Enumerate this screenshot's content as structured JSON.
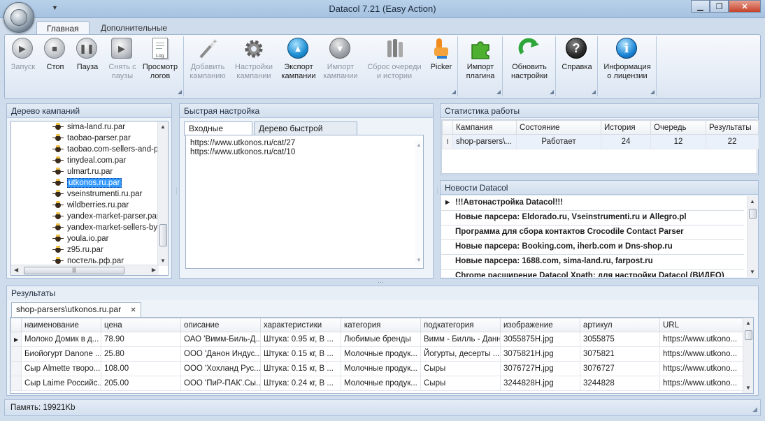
{
  "window": {
    "title": "Datacol 7.21 (Easy Action)",
    "qat_arrow": "▼",
    "minimize": "▁",
    "maximize": "❐",
    "close": "✕"
  },
  "ribbon_tabs": [
    "Главная",
    "Дополнительные"
  ],
  "ribbon": {
    "buttons": [
      {
        "id": "start",
        "line1": "Запуск",
        "line2": "",
        "icon": "play-icon",
        "disabled": true
      },
      {
        "id": "stop",
        "line1": "Стоп",
        "line2": "",
        "icon": "stop-icon",
        "disabled": false
      },
      {
        "id": "pause",
        "line1": "Пауза",
        "line2": "",
        "icon": "pause-icon",
        "disabled": false
      },
      {
        "id": "unpause",
        "line1": "Снять с",
        "line2": "паузы",
        "icon": "unpause-icon",
        "disabled": true
      },
      {
        "id": "logs",
        "line1": "Просмотр",
        "line2": "логов",
        "icon": "log-icon",
        "disabled": false
      },
      {
        "id": "add-campaign",
        "line1": "Добавить",
        "line2": "кампанию",
        "icon": "magic-wand-icon",
        "disabled": true
      },
      {
        "id": "campaign-settings",
        "line1": "Настройки",
        "line2": "кампании",
        "icon": "gear-icon",
        "disabled": true
      },
      {
        "id": "export",
        "line1": "Экспорт",
        "line2": "кампании",
        "icon": "export-icon",
        "disabled": false
      },
      {
        "id": "import",
        "line1": "Импорт",
        "line2": "кампании",
        "icon": "import-icon",
        "disabled": true
      },
      {
        "id": "reset-queue",
        "line1": "Сброс очереди",
        "line2": "и истории",
        "icon": "reset-icon",
        "disabled": true
      },
      {
        "id": "picker",
        "line1": "Picker",
        "line2": "",
        "icon": "picker-icon",
        "disabled": false
      },
      {
        "id": "import-plugin",
        "line1": "Импорт",
        "line2": "плагина",
        "icon": "puzzle-icon",
        "disabled": false
      },
      {
        "id": "update-settings",
        "line1": "Обновить",
        "line2": "настройки",
        "icon": "refresh-icon",
        "disabled": false
      },
      {
        "id": "help",
        "line1": "Справка",
        "line2": "",
        "icon": "help-icon",
        "disabled": false
      },
      {
        "id": "license",
        "line1": "Информация",
        "line2": "о лицензии",
        "icon": "info-icon",
        "disabled": false
      }
    ]
  },
  "tree_panel": {
    "title": "Дерево кампаний",
    "items": [
      "sima-land.ru.par",
      "taobao-parser.par",
      "taobao.com-sellers-and-pri",
      "tinydeal.com.par",
      "ulmart.ru.par",
      "utkonos.ru.par",
      "vseinstrumenti.ru.par",
      "wildberries.ru.par",
      "yandex-market-parser.par",
      "yandex-market-sellers-by-p",
      "youla.io.par",
      "z95.ru.par",
      "постель.рф.par"
    ],
    "selected_index": 5
  },
  "quick_panel": {
    "title": "Быстрая настройка",
    "tabs": [
      "Входные данные",
      "Дерево быстрой настройки"
    ],
    "input_lines": [
      "https://www.utkonos.ru/cat/27",
      "https://www.utkonos.ru/cat/10"
    ]
  },
  "stats_panel": {
    "title": "Статистика работы",
    "columns": [
      "Кампания",
      "Состояние",
      "История",
      "Очередь",
      "Результаты"
    ],
    "row": [
      "shop-parsers\\...",
      "Работает",
      "24",
      "12",
      "22"
    ],
    "row_marker": "I"
  },
  "news_panel": {
    "title": "Новости Datacol",
    "items": [
      "!!!Автонастройка Datacol!!!",
      "Новые парсера: Eldorado.ru, Vseinstrumenti.ru и Allegro.pl",
      "Программа для  сбора контактов Crocodile Contact Parser",
      "Новые парсера: Booking.com, iherb.com и Dns-shop.ru",
      "Новые парсера: 1688.com, sima-land.ru, farpost.ru",
      "Chrome расширение Datacol Xpath: для настройки Datacol (ВИДЕО)"
    ]
  },
  "results": {
    "title": "Результаты",
    "tab_label": "shop-parsers\\utkonos.ru.par",
    "tab_close": "✕",
    "columns": [
      "наименование",
      "цена",
      "описание",
      "характеристики",
      "категория",
      "подкатегория",
      "изображение",
      "артикул",
      "URL"
    ],
    "rows": [
      [
        "Молоко Домик в д...",
        "78.90",
        "ОАО 'Вимм-Биль-Д...",
        "Штука: 0.95 кг, В ...",
        "Любимые бренды",
        "Вимм - Билль - Данн",
        "3055875H.jpg",
        "3055875",
        "https://www.utkono..."
      ],
      [
        "Биойогурт Danone ...",
        "25.80",
        "ООО 'Данон Индус...",
        "Штука: 0.15 кг, В ...",
        "Молочные продук...",
        "Йогурты, десерты ...",
        "3075821H.jpg",
        "3075821",
        "https://www.utkono..."
      ],
      [
        "Сыр Almette творо...",
        "108.00",
        "ООО 'Хохланд Рус...",
        "Штука: 0.15 кг, В ...",
        "Молочные продук...",
        "Сыры",
        "3076727H.jpg",
        "3076727",
        "https://www.utkono..."
      ],
      [
        "Сыр Laime Российс...",
        "205.00",
        "ООО 'ПиР-ПАК'.Сы...",
        "Штука: 0.24 кг, В ...",
        "Молочные продук...",
        "Сыры",
        "3244828H.jpg",
        "3244828",
        "https://www.utkono..."
      ]
    ]
  },
  "status": {
    "memory": "Память: 19921Kb"
  }
}
